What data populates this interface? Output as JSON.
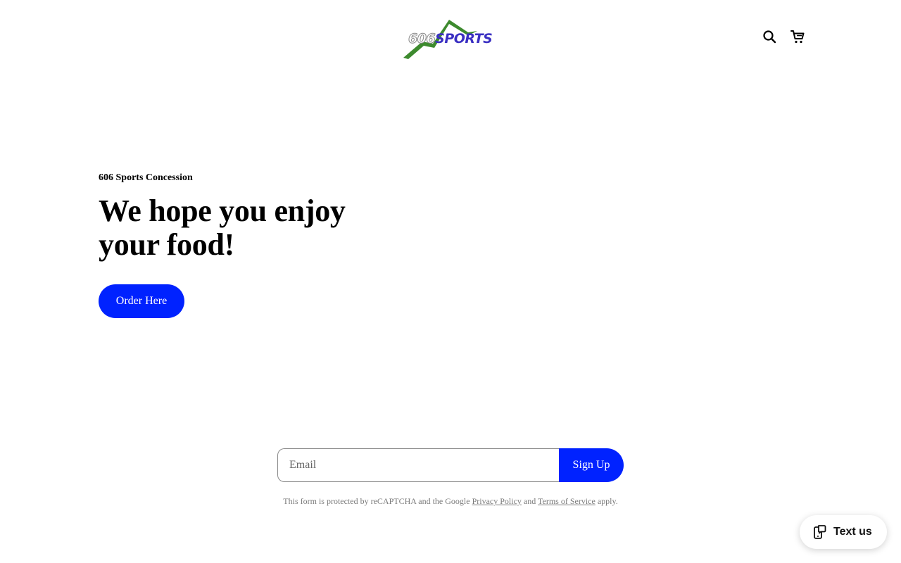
{
  "header": {
    "logo": {
      "number": "606",
      "word": "SPORTS",
      "mountain_color": "#3d8a2e",
      "word_color": "#3a2fc2"
    },
    "icons": {
      "search": "search-icon",
      "cart": "cart-icon"
    }
  },
  "hero": {
    "eyebrow": "606 Sports Concession",
    "headline": "We hope you enjoy your food!",
    "cta_label": "Order Here"
  },
  "newsletter": {
    "email_placeholder": "Email",
    "email_value": "",
    "submit_label": "Sign Up",
    "recaptcha_prefix": "This form is protected by reCAPTCHA and the Google ",
    "privacy_link": "Privacy Policy",
    "recaptcha_and": " and ",
    "terms_link": "Terms of Service",
    "recaptcha_suffix": " apply."
  },
  "widget": {
    "label": "Text us",
    "icon": "chat-phone-icon"
  },
  "colors": {
    "accent": "#0022ff",
    "background": "#ffffff"
  }
}
